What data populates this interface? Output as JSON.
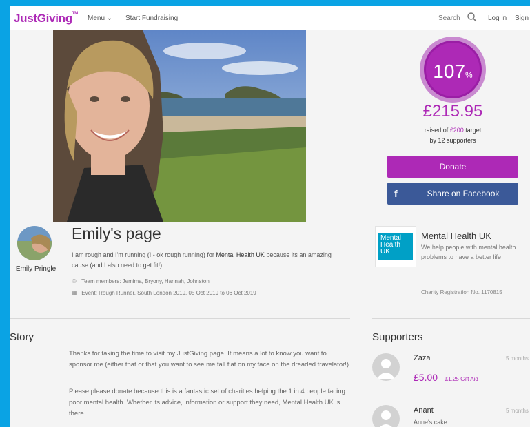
{
  "header": {
    "logo": "JustGiving",
    "logo_tm": "TM",
    "menu": "Menu",
    "start": "Start Fundraising",
    "search": "Search",
    "login": "Log in",
    "sign": "Sign"
  },
  "fundraising": {
    "percent": "107",
    "percent_sign": "%",
    "raised": "£215.95",
    "raised_of": "raised of",
    "target_amount": "£200",
    "target_word": "target",
    "by": "by",
    "supporters_count": "12",
    "supporters_word": "supporters",
    "donate_label": "Donate",
    "share_icon": "f",
    "share_label": "Share on Facebook"
  },
  "page": {
    "owner_name": "Emily Pringle",
    "title": "Emily's page",
    "intro_a": "I am rough and I'm running (! - ok rough running) for ",
    "intro_charity": "Mental Health UK",
    "intro_b": " because its an amazing cause (and I also need to get fit!)",
    "team": "Team members: Jemima, Bryony, Hannah, Johnston",
    "event": "Event: Rough Runner, South London 2019, 05 Oct 2019 to 06 Oct 2019"
  },
  "charity": {
    "logo_l1": "Mental",
    "logo_l2": "Health",
    "logo_l3": "UK",
    "name": "Mental Health UK",
    "description": "We help people with mental health problems to have a better life",
    "registration": "Charity Registration No. 1170815"
  },
  "story": {
    "heading": "Story",
    "p1": "Thanks for taking the time to visit my JustGiving page. It means a lot to know you want to sponsor me (either that or that you want to see me fall flat on my face on the dreaded travelator!)",
    "p2": "Please please donate because this is a fantastic set of charities helping the 1 in 4 people facing poor mental health. Whether its advice, information or support they need, Mental Health UK is there."
  },
  "supporters": {
    "heading": "Supporters",
    "items": [
      {
        "name": "Zaza",
        "time": "5 months",
        "amount": "£5.00",
        "gift_aid": "+ £1.25 Gift Aid"
      },
      {
        "name": "Anant",
        "time": "5 months",
        "message": "Anne's cake"
      }
    ]
  },
  "colors": {
    "brand": "#ad29b6",
    "facebook": "#3b5998",
    "frame": "#0aa3e4"
  }
}
